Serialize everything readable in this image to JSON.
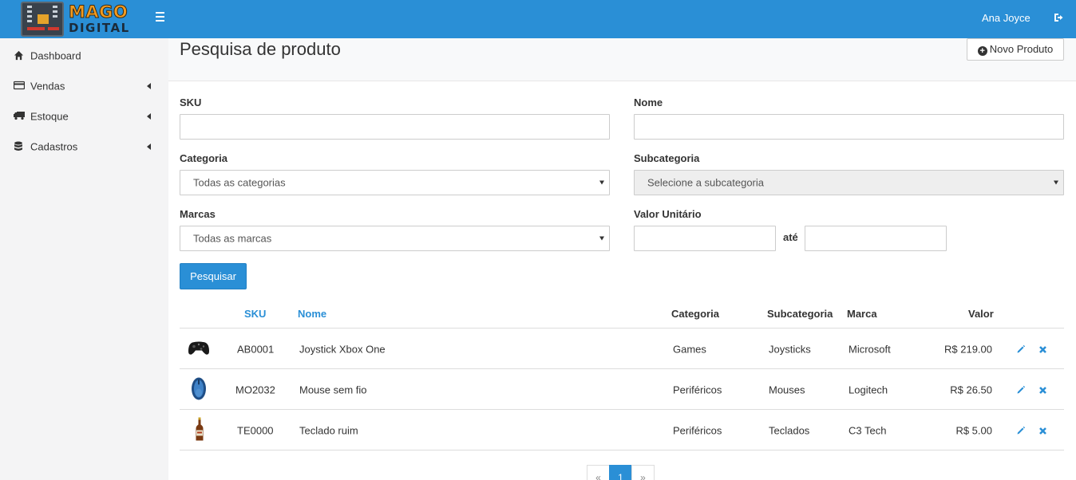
{
  "header": {
    "logo_line1": "MAGO",
    "logo_line2": "DIGITAL",
    "user_name": "Ana Joyce",
    "menu_icon": "hamburger-icon",
    "logout_icon": "sign-out-icon"
  },
  "sidebar": {
    "items": [
      {
        "label": "Dashboard",
        "icon": "home-icon",
        "has_submenu": false
      },
      {
        "label": "Vendas",
        "icon": "credit-card-icon",
        "has_submenu": true
      },
      {
        "label": "Estoque",
        "icon": "truck-icon",
        "has_submenu": true
      },
      {
        "label": "Cadastros",
        "icon": "database-icon",
        "has_submenu": true
      }
    ]
  },
  "page": {
    "title": "Pesquisa de produto",
    "new_button": "Novo Produto"
  },
  "filters": {
    "sku_label": "SKU",
    "sku_value": "",
    "nome_label": "Nome",
    "nome_value": "",
    "categoria_label": "Categoria",
    "categoria_selected": "Todas as categorias",
    "subcategoria_label": "Subcategoria",
    "subcategoria_selected": "Selecione a subcategoria",
    "marcas_label": "Marcas",
    "marcas_selected": "Todas as marcas",
    "valor_label": "Valor Unitário",
    "valor_min": "",
    "ate_label": "até",
    "valor_max": "",
    "search_button": "Pesquisar"
  },
  "table": {
    "headers": {
      "sku": "SKU",
      "nome": "Nome",
      "categoria": "Categoria",
      "subcategoria": "Subcategoria",
      "marca": "Marca",
      "valor": "Valor"
    },
    "rows": [
      {
        "image": "gamepad-image",
        "sku": "AB0001",
        "nome": "Joystick Xbox One",
        "categoria": "Games",
        "subcategoria": "Joysticks",
        "marca": "Microsoft",
        "valor": "R$ 219.00"
      },
      {
        "image": "mouse-image",
        "sku": "MO2032",
        "nome": "Mouse sem fio",
        "categoria": "Periféricos",
        "subcategoria": "Mouses",
        "marca": "Logitech",
        "valor": "R$ 26.50"
      },
      {
        "image": "bottle-image",
        "sku": "TE0000",
        "nome": "Teclado ruim",
        "categoria": "Periféricos",
        "subcategoria": "Teclados",
        "marca": "C3 Tech",
        "valor": "R$ 5.00"
      }
    ]
  },
  "pagination": {
    "prev": "«",
    "current": "1",
    "next": "»"
  },
  "colors": {
    "primary": "#2a8fd6",
    "sidebar_bg": "#f4f4f5",
    "logo_orange": "#f29a1f"
  }
}
